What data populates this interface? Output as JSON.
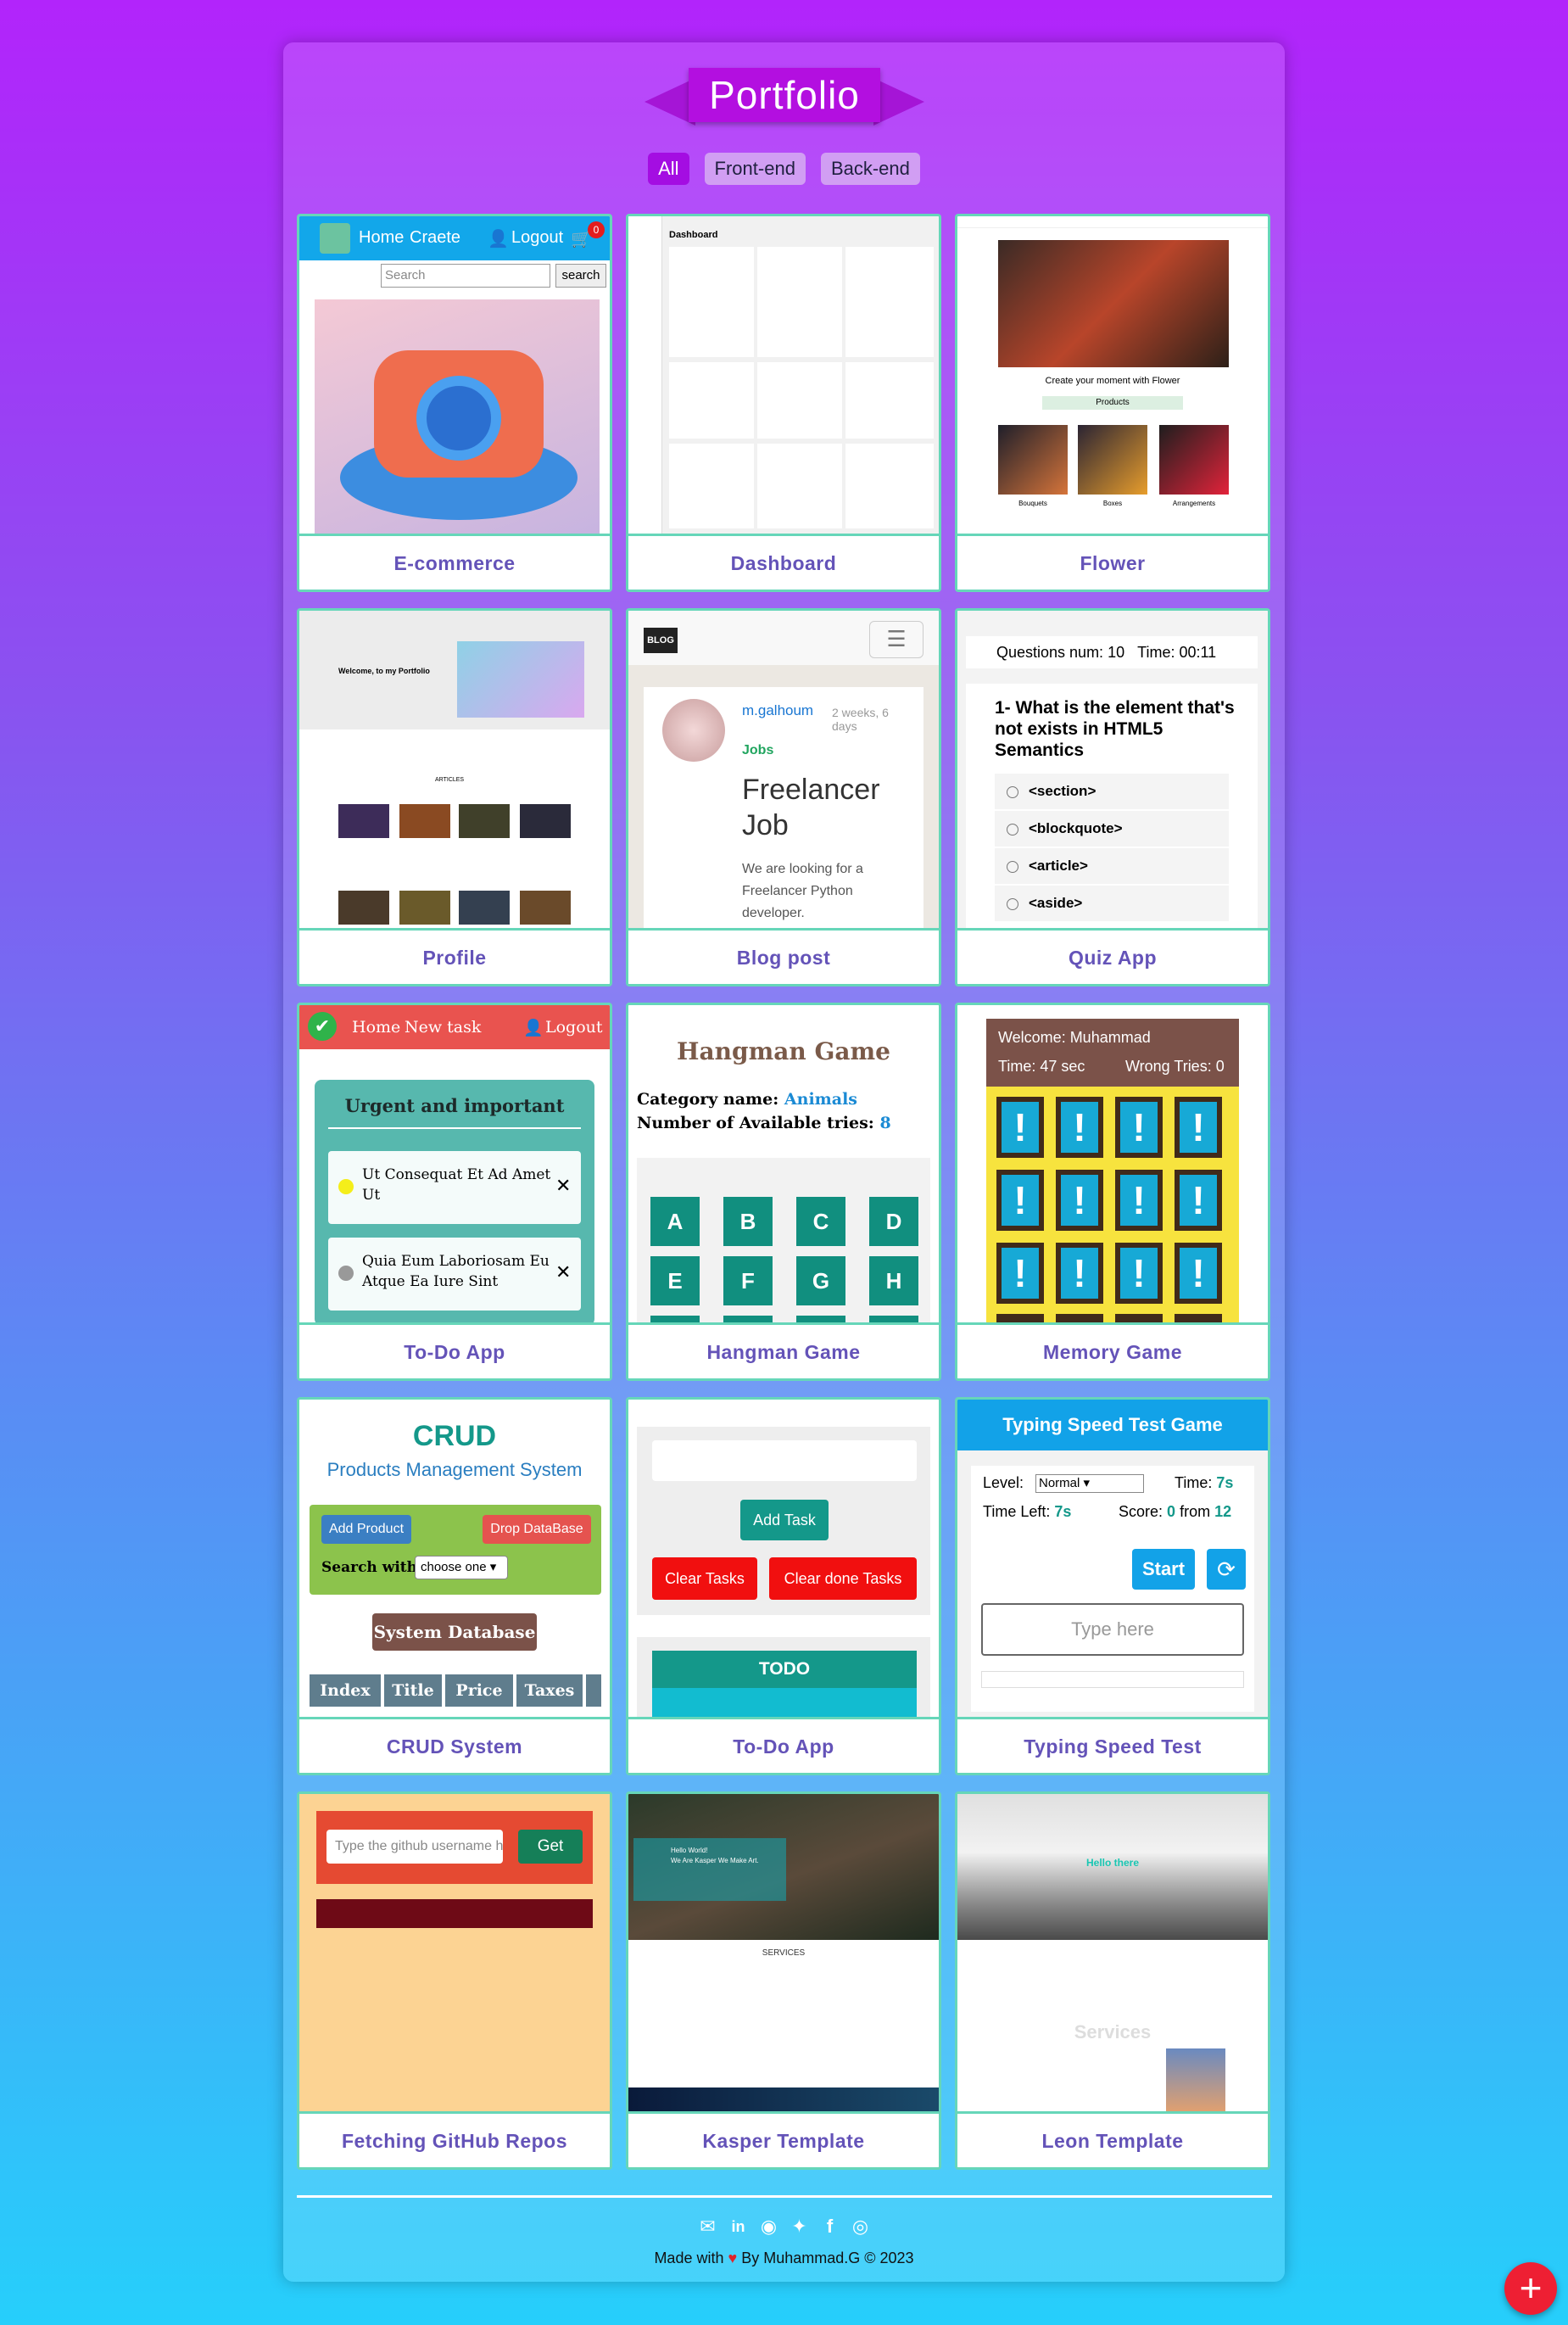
{
  "title": "Portfolio",
  "filters": [
    "All",
    "Front-end",
    "Back-end"
  ],
  "projects": [
    {
      "name": "E-commerce"
    },
    {
      "name": "Dashboard"
    },
    {
      "name": "Flower"
    },
    {
      "name": "Profile"
    },
    {
      "name": "Blog post"
    },
    {
      "name": "Quiz App"
    },
    {
      "name": "To-Do App"
    },
    {
      "name": "Hangman Game"
    },
    {
      "name": "Memory Game"
    },
    {
      "name": "CRUD System"
    },
    {
      "name": "To-Do App"
    },
    {
      "name": "Typing Speed Test"
    },
    {
      "name": "Fetching GitHub Repos"
    },
    {
      "name": "Kasper Template"
    },
    {
      "name": "Leon Template"
    }
  ],
  "thumbs": {
    "ecom": {
      "home": "Home",
      "create": "Craete",
      "logout": "Logout",
      "badge": "0",
      "search_placeholder": "Search",
      "search_btn": "search"
    },
    "dashboard": {
      "title": "Dashboard"
    },
    "flower": {
      "tagline": "Create your moment with Flower",
      "products": "Products",
      "labels": [
        "Bouquets",
        "Boxes",
        "Arrangements"
      ]
    },
    "profile": {
      "heading": "Welcome, to my Portfolio",
      "articles": "ARTICLES"
    },
    "blog": {
      "logo": "BLOG",
      "author": "m.galhoum",
      "when": "2 weeks, 6 days",
      "tag": "Jobs",
      "heading": "Freelancer Job",
      "body": "We are looking for a Freelancer Python developer."
    },
    "quiz": {
      "num_label": "Questions num:",
      "num": "10",
      "time_label": "Time:",
      "time": "00:11",
      "question": "1- What is the element that's not exists in HTML5 Semantics",
      "options": [
        "<section>",
        "<blockquote>",
        "<article>",
        "<aside>"
      ]
    },
    "todo": {
      "home": "Home",
      "new": "New task",
      "logout": "Logout",
      "heading": "Urgent and important",
      "tasks": [
        "Ut Consequat Et Ad Amet Ut",
        "Quia Eum Laboriosam Eu Atque Ea Iure Sint"
      ]
    },
    "hangman": {
      "heading": "Hangman Game",
      "cat_label": "Category name:",
      "category": "Animals",
      "tries_label": "Number of Available tries:",
      "tries": "8",
      "letters": [
        "A",
        "B",
        "C",
        "D",
        "E",
        "F",
        "G",
        "H"
      ]
    },
    "memory": {
      "welcome": "Welcome: Muhammad",
      "time": "Time: 47 sec",
      "wrong": "Wrong Tries: 0",
      "tile": "!"
    },
    "crud": {
      "title": "CRUD",
      "subtitle": "Products Management System",
      "add": "Add Product",
      "drop": "Drop DataBase",
      "search_label": "Search with:",
      "select": "choose one",
      "db": "System Database",
      "cols": [
        "Index",
        "Title",
        "Price",
        "Taxes"
      ]
    },
    "todo2": {
      "add": "Add Task",
      "clear": "Clear Tasks",
      "clear_done": "Clear done Tasks",
      "todo": "TODO"
    },
    "typing": {
      "title": "Typing Speed Test Game",
      "level_label": "Level:",
      "level": "Normal",
      "time_label": "Time:",
      "time": "7s",
      "left_label": "Time Left:",
      "left": "7s",
      "score_label": "Score:",
      "score": "0",
      "from_label": "from",
      "total": "12",
      "start": "Start",
      "placeholder": "Type here"
    },
    "github": {
      "placeholder": "Type the github username h",
      "get": "Get"
    },
    "kasper": {
      "hello": "Hello World!",
      "sub": "We Are Kasper We Make Art.",
      "services": "SERVICES"
    },
    "leon": {
      "hello": "Hello there",
      "services": "Services"
    }
  },
  "footer": {
    "made_prefix": "Made with",
    "made_suffix": "By Muhammad.G © 2023",
    "heart": "♥"
  },
  "fab": "+",
  "colors": {
    "accent": "#a40de2",
    "card_border": "#66d6b9",
    "caption": "#6453b8"
  }
}
